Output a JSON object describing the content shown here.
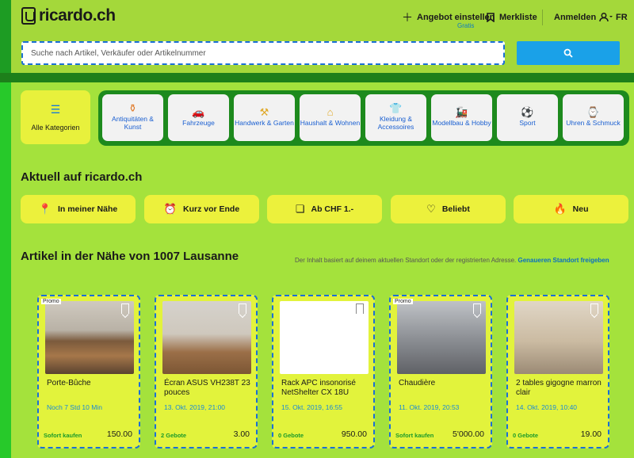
{
  "brand": {
    "logo_text": "ricardo.ch"
  },
  "header": {
    "sell_label": "Angebot einstellen",
    "sell_sub": "Gratis",
    "watchlist_label": "Merkliste",
    "login_label": "Anmelden",
    "lang_label": "FR"
  },
  "search": {
    "placeholder": "Suche nach Artikel, Verkäufer oder Artikelnummer"
  },
  "categories": {
    "all_label": "Alle Kategorien",
    "items": [
      {
        "label": "Antiquitäten & Kunst",
        "icon": "vase-icon"
      },
      {
        "label": "Fahrzeuge",
        "icon": "car-icon"
      },
      {
        "label": "Handwerk & Garten",
        "icon": "tools-icon"
      },
      {
        "label": "Haushalt & Wohnen",
        "icon": "lamp-icon"
      },
      {
        "label": "Kleidung & Accessoires",
        "icon": "shirt-icon"
      },
      {
        "label": "Modellbau & Hobby",
        "icon": "train-icon"
      },
      {
        "label": "Sport",
        "icon": "ball-icon"
      },
      {
        "label": "Uhren & Schmuck",
        "icon": "watch-icon"
      }
    ]
  },
  "current": {
    "heading": "Aktuell auf ricardo.ch",
    "chips": [
      {
        "label": "In meiner Nähe",
        "icon": "location-pin-icon"
      },
      {
        "label": "Kurz vor Ende",
        "icon": "alarm-clock-icon"
      },
      {
        "label": "Ab CHF 1.-",
        "icon": "one-box-icon"
      },
      {
        "label": "Beliebt",
        "icon": "heart-icon"
      },
      {
        "label": "Neu",
        "icon": "flame-icon"
      }
    ]
  },
  "nearby": {
    "heading": "Artikel in der Nähe von 1007 Lausanne",
    "note": "Der Inhalt basiert auf deinem aktuellen Standort oder der registrierten Adresse.",
    "note_link": "Genaueren Standort freigeben",
    "items": [
      {
        "promo": "Promo",
        "title": "Porte-Bûche",
        "date": "Noch 7 Std 10 Min",
        "sub": "Sofort kaufen",
        "price": "150.00"
      },
      {
        "promo": "",
        "title": "Écran ASUS VH238T 23 pouces",
        "date": "13. Okt. 2019, 21:00",
        "sub": "2 Gebote",
        "price": "3.00"
      },
      {
        "promo": "",
        "title": "Rack APC insonorisé NetShelter CX 18U",
        "date": "15. Okt. 2019, 16:55",
        "sub": "0 Gebote",
        "price": "950.00"
      },
      {
        "promo": "Promo",
        "title": "Chaudière",
        "date": "11. Okt. 2019, 20:53",
        "sub": "Sofort kaufen",
        "price": "5'000.00"
      },
      {
        "promo": "",
        "title": "2 tables gigogne marron clair",
        "date": "14. Okt. 2019, 10:40",
        "sub": "0 Gebote",
        "price": "19.00"
      }
    ]
  },
  "colors": {
    "header_bg": "#a4d83a",
    "accent_blue": "#1aa1e8",
    "chip_yellow": "#ecf13c",
    "dark_green": "#1d7f1a"
  }
}
